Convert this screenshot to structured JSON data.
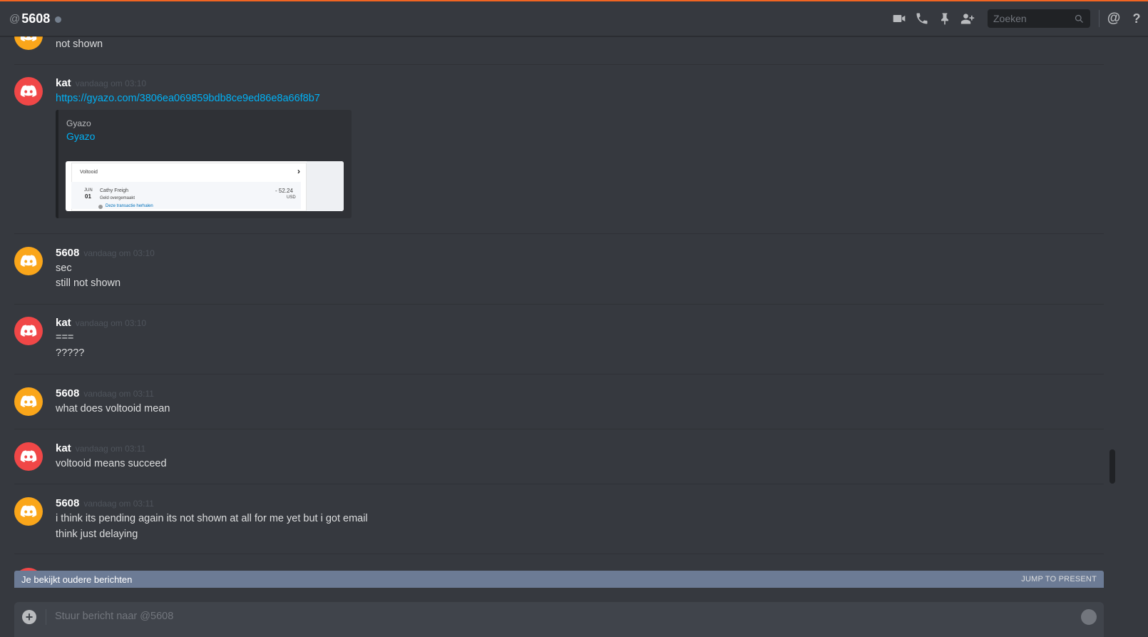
{
  "header": {
    "at_symbol": "@",
    "dm_name": "5608",
    "search_placeholder": "Zoeken",
    "icons": [
      "video-icon",
      "phone-icon",
      "pin-icon",
      "add-user-icon",
      "search-icon",
      "mention-icon",
      "help-icon"
    ],
    "mention_label": "@",
    "help_label": "?"
  },
  "messages": [
    {
      "author": "",
      "timestamp": "",
      "lines": [
        "not shown"
      ]
    },
    {
      "author": "kat",
      "timestamp": "vandaag om 03:10",
      "link": "https://gyazo.com/3806ea069859bdb8ce9ed86e8a66f8b7",
      "embed": {
        "provider": "Gyazo",
        "title": "Gyazo",
        "thumb": {
          "heading": "Voltooid",
          "chevron": "›",
          "month": "JUN",
          "day": "01",
          "payee": "Cathy Freigh",
          "desc": "Geld overgemaakt",
          "amount": "- 52.24",
          "currency": "USD",
          "repeat": "Deze transactie herhalen"
        }
      }
    },
    {
      "author": "5608",
      "timestamp": "vandaag om 03:10",
      "lines": [
        "sec",
        "still not shown"
      ]
    },
    {
      "author": "kat",
      "timestamp": "vandaag om 03:10",
      "lines": [
        "===",
        "?????"
      ]
    },
    {
      "author": "5608",
      "timestamp": "vandaag om 03:11",
      "lines": [
        "what does voltooid mean"
      ]
    },
    {
      "author": "kat",
      "timestamp": "vandaag om 03:11",
      "lines": [
        "voltooid means succeed"
      ]
    },
    {
      "author": "5608",
      "timestamp": "vandaag om 03:11",
      "lines": [
        "i think its pending again its not shown at all for me yet but i got email",
        "think just delaying"
      ]
    }
  ],
  "banner": {
    "left": "Je bekijkt oudere berichten",
    "right": "JUMP TO PRESENT"
  },
  "composer": {
    "placeholder": "Stuur bericht naar @5608"
  },
  "colors": {
    "background": "#36393f",
    "accent_top": "#f26522",
    "link": "#00b0f4",
    "avatar_kat": "#f04747",
    "avatar_5608": "#faa61a"
  }
}
